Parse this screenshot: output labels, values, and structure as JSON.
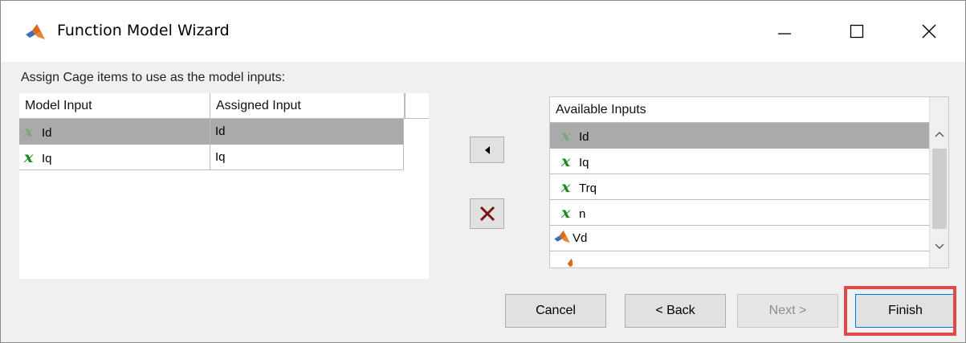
{
  "window": {
    "title": "Function Model Wizard",
    "icon": "matlab-icon"
  },
  "prompt": "Assign Cage items to use as the model inputs:",
  "left_table": {
    "headers": [
      "Model Input",
      "Assigned Input"
    ],
    "rows": [
      {
        "icon": "variable-x-icon",
        "model_input": "Id",
        "assigned_input": "Id",
        "selected": true
      },
      {
        "icon": "variable-x-icon",
        "model_input": "Iq",
        "assigned_input": "Iq",
        "selected": false
      }
    ]
  },
  "right_list": {
    "header": "Available Inputs",
    "items": [
      {
        "icon": "variable-x-icon",
        "label": "Id",
        "selected": true
      },
      {
        "icon": "variable-x-icon",
        "label": "Iq",
        "selected": false
      },
      {
        "icon": "variable-x-icon",
        "label": "Trq",
        "selected": false
      },
      {
        "icon": "variable-x-icon",
        "label": "n",
        "selected": false
      },
      {
        "icon": "matlab-icon",
        "label": "Vd",
        "selected": false
      }
    ]
  },
  "icons": {
    "variable": "x",
    "assign": "triangle-left-icon",
    "remove": "red-x-icon"
  },
  "buttons": {
    "cancel": "Cancel",
    "back": "< Back",
    "next": "Next >",
    "finish": "Finish"
  },
  "colors": {
    "variable_icon": "#1a8a1a",
    "remove_icon": "#7a1414",
    "highlight": "#e0494a",
    "selected_row": "#aaaaaa"
  }
}
